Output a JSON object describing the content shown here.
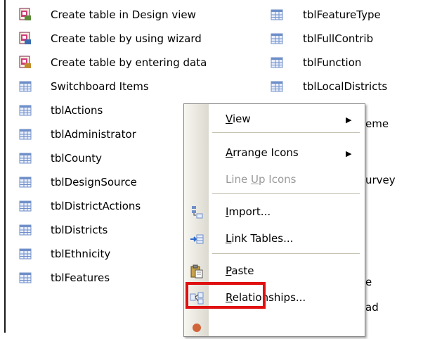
{
  "left_column": [
    {
      "icon": "create-design-icon",
      "label": "Create table in Design view"
    },
    {
      "icon": "create-wizard-icon",
      "label": "Create table by using wizard"
    },
    {
      "icon": "create-data-icon",
      "label": "Create table by entering data"
    },
    {
      "icon": "table-icon",
      "label": "Switchboard Items"
    },
    {
      "icon": "table-icon",
      "label": "tblActions"
    },
    {
      "icon": "table-icon",
      "label": "tblAdministrator"
    },
    {
      "icon": "table-icon",
      "label": "tblCounty"
    },
    {
      "icon": "table-icon",
      "label": "tblDesignSource"
    },
    {
      "icon": "table-icon",
      "label": "tblDistrictActions"
    },
    {
      "icon": "table-icon",
      "label": "tblDistricts"
    },
    {
      "icon": "table-icon",
      "label": "tblEthnicity"
    },
    {
      "icon": "table-icon",
      "label": "tblFeatures"
    }
  ],
  "right_column": [
    {
      "icon": "table-icon",
      "label": "tblFeatureType"
    },
    {
      "icon": "table-icon",
      "label": "tblFullContrib"
    },
    {
      "icon": "table-icon",
      "label": "tblFunction"
    },
    {
      "icon": "table-icon",
      "label": "tblLocalDistricts"
    }
  ],
  "right_peek": {
    "a": "eme",
    "b": "urvey",
    "c": "e",
    "d": "ad"
  },
  "context_menu": {
    "view": {
      "pre": "",
      "u": "V",
      "post": "iew",
      "arrow": "▶"
    },
    "arrange": {
      "pre": "",
      "u": "A",
      "post": "rrange Icons",
      "arrow": "▶"
    },
    "lineup": {
      "pre": "Line ",
      "u": "U",
      "post": "p Icons"
    },
    "import": {
      "pre": "",
      "u": "I",
      "post": "mport..."
    },
    "link": {
      "pre": "",
      "u": "L",
      "post": "ink Tables..."
    },
    "paste": {
      "pre": "",
      "u": "P",
      "post": "aste"
    },
    "relationships": {
      "pre": "",
      "u": "R",
      "post": "elationships..."
    }
  },
  "colors": {
    "highlight": "#e01010",
    "table_icon": "#6f8fc9"
  }
}
